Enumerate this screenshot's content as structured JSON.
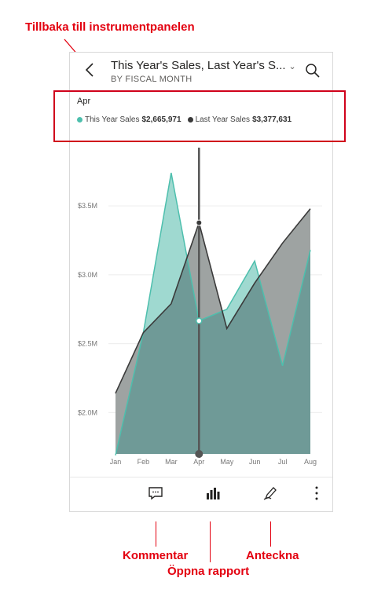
{
  "annotations": {
    "back": "Tillbaka till instrumentpanelen",
    "comment": "Kommentar",
    "open_report": "Öppna rapport",
    "annotate": "Anteckna"
  },
  "header": {
    "title": "This Year's Sales, Last Year's S...",
    "subtitle": "BY FISCAL MONTH",
    "back_icon": "chevron-left-icon",
    "search_icon": "search-icon",
    "dropdown_icon": "chevron-down-icon"
  },
  "tooltip": {
    "month": "Apr",
    "items": [
      {
        "label": "This Year Sales",
        "value": "$2,665,971",
        "color": "#4dbfad"
      },
      {
        "label": "Last Year Sales",
        "value": "$3,377,631",
        "color": "#3a3a3a"
      }
    ]
  },
  "toolbar": {
    "comment_icon": "comment-icon",
    "report_icon": "bar-chart-icon",
    "annotate_icon": "pen-icon",
    "more_icon": "more-icon"
  },
  "chart_data": {
    "type": "area",
    "categories": [
      "Jan",
      "Feb",
      "Mar",
      "Apr",
      "May",
      "Jun",
      "Jul",
      "Aug"
    ],
    "series": [
      {
        "name": "Last Year Sales",
        "values": [
          2140000,
          2580000,
          2790000,
          3377631,
          2610000,
          2940000,
          3230000,
          3480000
        ],
        "color": "#3a3a3a",
        "fill": "#9ea3a2"
      },
      {
        "name": "This Year Sales",
        "values": [
          1690000,
          2580000,
          3740000,
          2665971,
          2750000,
          3100000,
          2340000,
          3180000
        ],
        "color": "#4dbfad",
        "fill": "#9fd9d0"
      }
    ],
    "overlap_fill": "#6f9a97",
    "y_ticks": [
      "$2.0M",
      "$2.5M",
      "$3.0M",
      "$3.5M"
    ],
    "y_tick_values": [
      2000000,
      2500000,
      3000000,
      3500000
    ],
    "ylim": [
      1700000,
      3900000
    ],
    "selected_index": 3,
    "grid": true
  }
}
